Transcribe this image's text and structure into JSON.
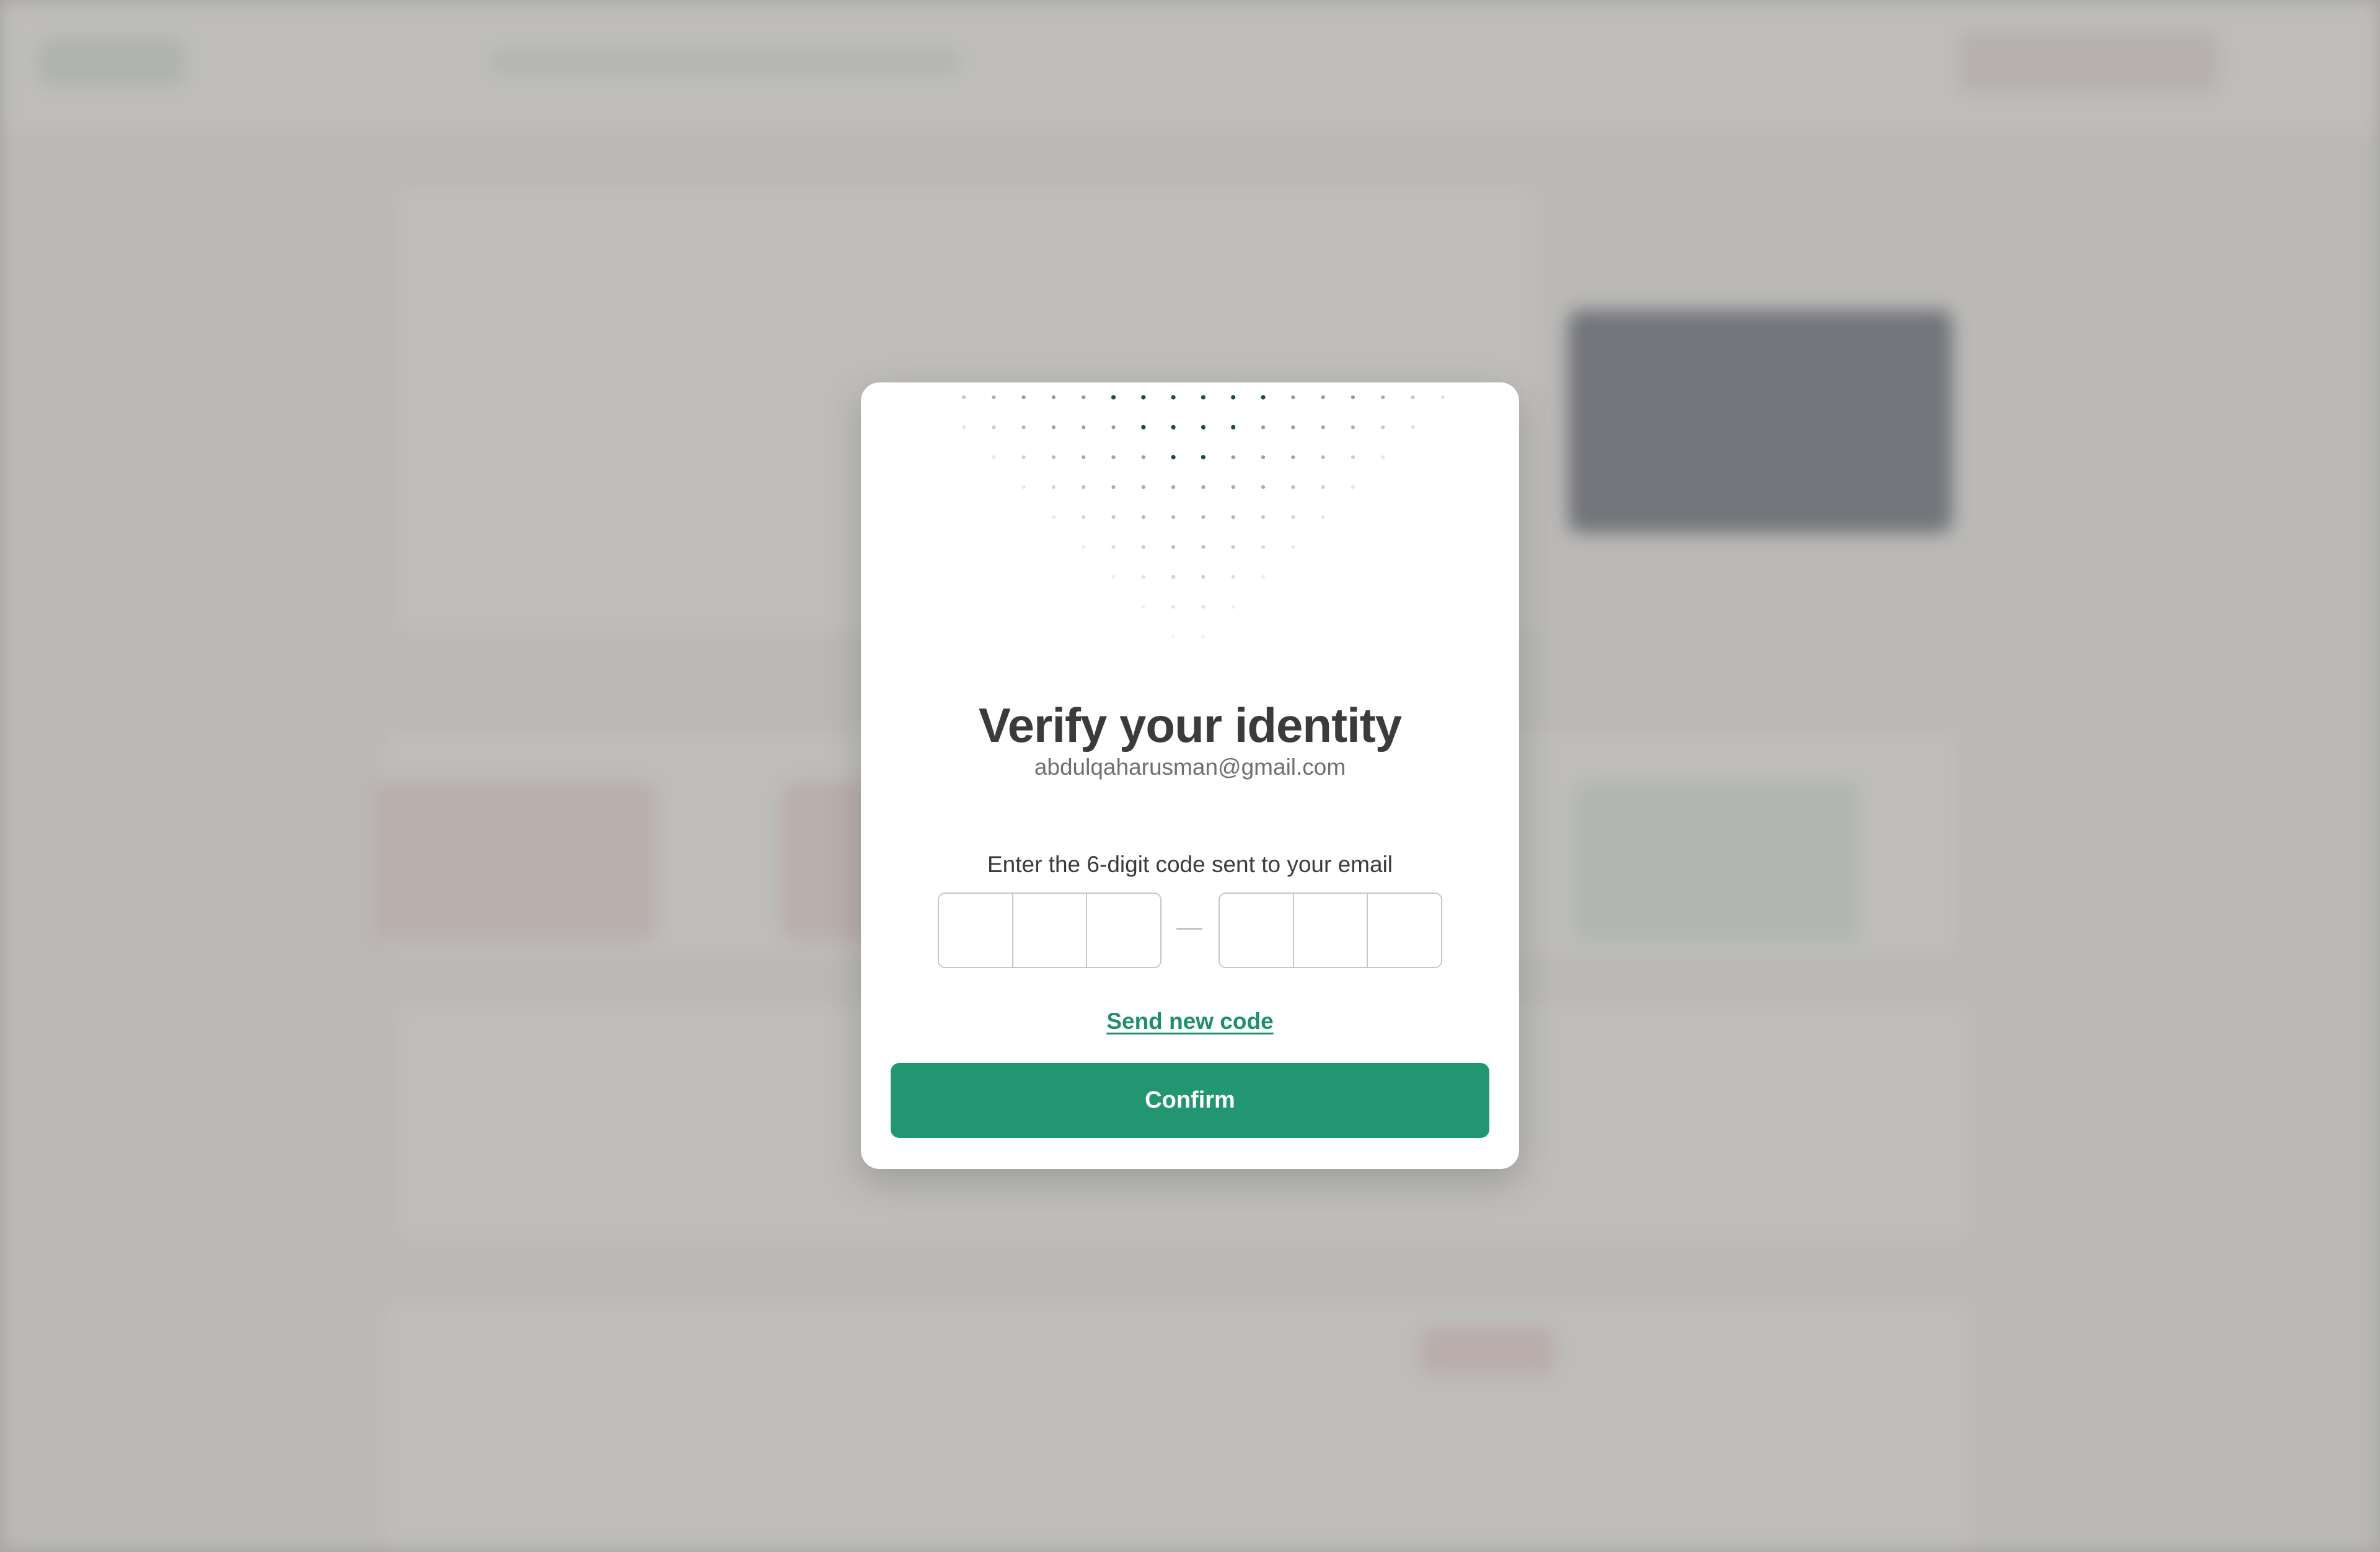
{
  "modal": {
    "title": "Verify your identity",
    "email": "abdulqaharusman@gmail.com",
    "instruction": "Enter the 6-digit code sent to your email",
    "code": {
      "digits": [
        "",
        "",
        "",
        "",
        "",
        ""
      ]
    },
    "send_new_code_label": "Send new code",
    "confirm_label": "Confirm"
  },
  "colors": {
    "accent": "#229671",
    "link": "#1f8f6b",
    "title": "#3b3b3b",
    "dot_dark": "#1e4d40",
    "dot_light": "#9a9a9a"
  }
}
